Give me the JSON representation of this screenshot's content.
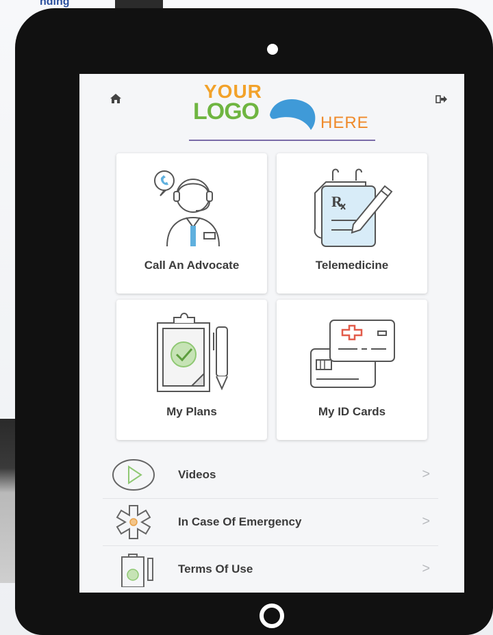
{
  "background": {
    "corner_text": "nding"
  },
  "header": {
    "home_icon": "home-icon",
    "logout_icon": "logout-icon",
    "logo": {
      "line1": "YOUR",
      "line2": "LOGO",
      "line3": "HERE"
    }
  },
  "tiles": [
    {
      "label": "Call An Advocate",
      "icon": "advocate-headset-icon"
    },
    {
      "label": "Telemedicine",
      "icon": "prescription-pad-icon"
    },
    {
      "label": "My Plans",
      "icon": "clipboard-check-icon"
    },
    {
      "label": "My ID Cards",
      "icon": "id-cards-icon"
    }
  ],
  "menu": [
    {
      "label": "Videos",
      "icon": "play-icon",
      "chevron": ">"
    },
    {
      "label": "In Case Of Emergency",
      "icon": "medical-star-icon",
      "chevron": ">"
    },
    {
      "label": "Terms Of Use",
      "icon": "clipboard-icon",
      "chevron": ">"
    }
  ],
  "colors": {
    "logo_your": "#f2a22a",
    "logo_logo": "#6fb541",
    "logo_swoosh": "#3f9ad8",
    "logo_here": "#ef8a2a",
    "icon_accent_blue": "#5fb0de",
    "icon_accent_green": "#8fc873",
    "icon_accent_red": "#e25b4a"
  }
}
